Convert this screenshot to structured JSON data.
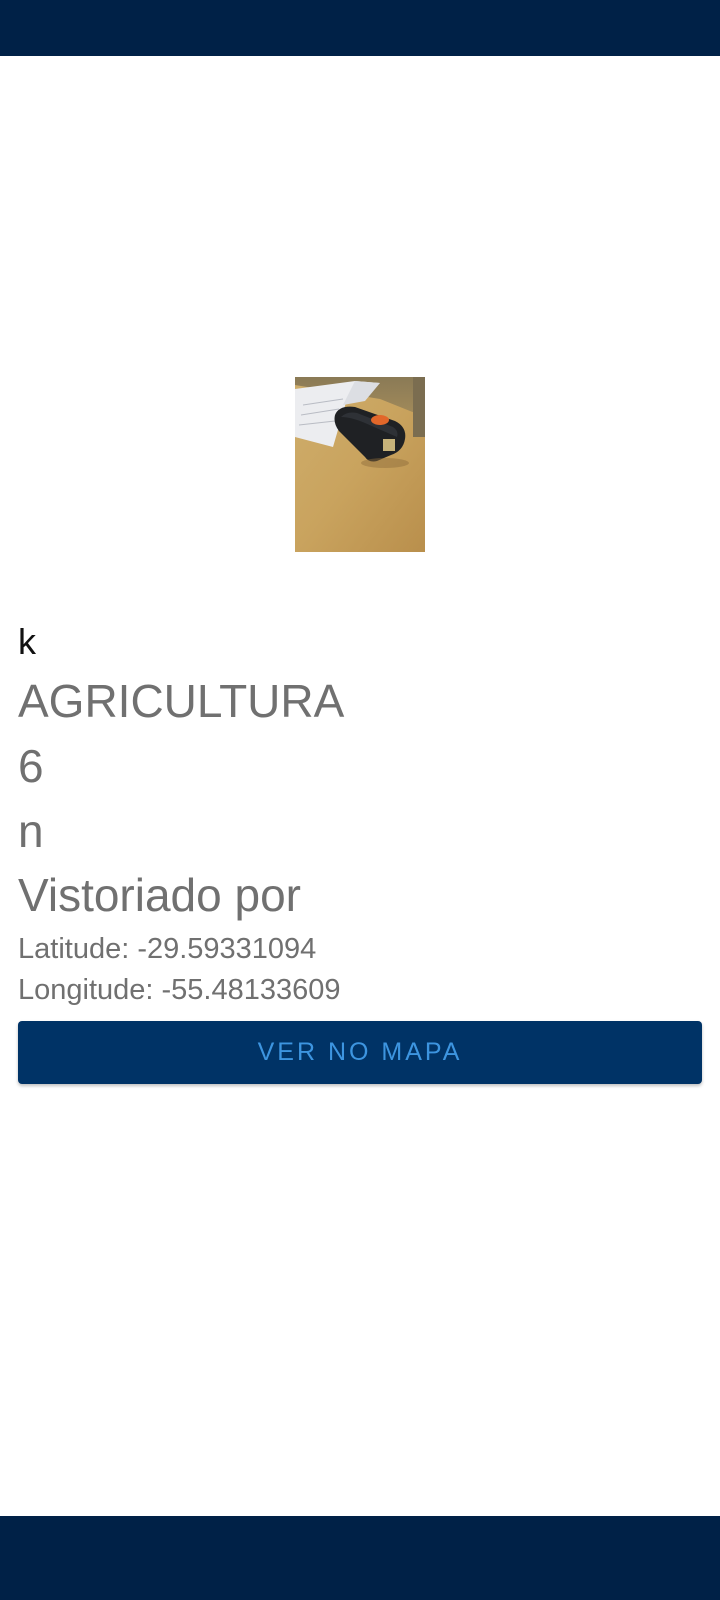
{
  "colors": {
    "system_bar": "#002147",
    "button_background": "#003366",
    "button_text": "#3d95e0",
    "secondary_text": "#707070",
    "primary_text": "#111111"
  },
  "photo": {
    "subject": "stapler-on-desk"
  },
  "details": {
    "name": "k",
    "category": "AGRICULTURA",
    "number": "6",
    "field_n": "n",
    "inspected_by": "Vistoriado por",
    "latitude": "Latitude: -29.59331094",
    "longitude": "Longitude: -55.48133609"
  },
  "actions": {
    "map_button_label": "VER NO MAPA"
  }
}
